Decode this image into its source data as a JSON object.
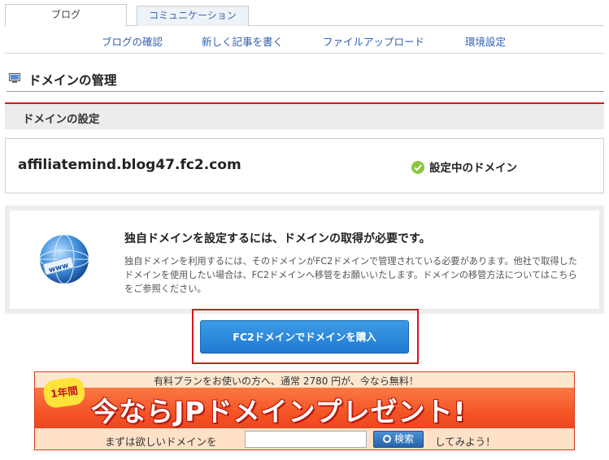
{
  "tabs": [
    {
      "label": "ブログ",
      "active": true
    },
    {
      "label": "コミュニケーション",
      "active": false
    }
  ],
  "subnav": [
    "ブログの確認",
    "新しく記事を書く",
    "ファイルアップロード",
    "環境設定"
  ],
  "page_title": "ドメインの管理",
  "section_title": "ドメインの設定",
  "domain": {
    "name": "affiliatemind.blog47.fc2.com",
    "status": "設定中のドメイン"
  },
  "info": {
    "title": "独自ドメインを設定するには、ドメインの取得が必要です。",
    "body": "独自ドメインを利用するには、そのドメインがFC2ドメインで管理されている必要があります。他社で取得したドメインを使用したい場合は、FC2ドメインへ移管をお願いいたします。ドメインの移管方法についてはこちらをご参照ください。",
    "globe_label": "www"
  },
  "buy_button": "FC2ドメインでドメインを購入",
  "banner": {
    "top_text": "有料プランをお使いの方へ、通常 2780 円が、今なら無料！",
    "badge": "1年間",
    "headline": "今ならJPドメインプレゼント!",
    "search_prefix": "まずは欲しいドメインを",
    "search_value": "",
    "search_button": "検索",
    "search_suffix": "してみよう！"
  },
  "colors": {
    "accent_red": "#d8151d",
    "link_blue": "#2f5fb3",
    "button_blue": "#1f7ad1",
    "status_green": "#8cc63f"
  }
}
